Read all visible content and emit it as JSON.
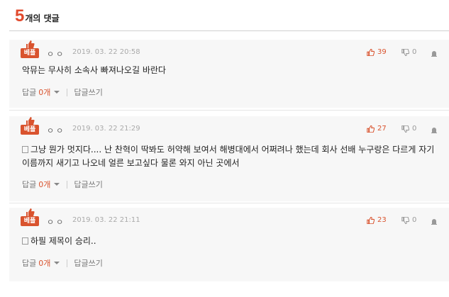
{
  "header": {
    "count": "5",
    "label": "개의 댓글"
  },
  "comments": [
    {
      "badge": "베플",
      "author": "ㅇㅇ",
      "date": "2019. 03. 22 20:58",
      "likes": "39",
      "dislikes": "0",
      "text": "악뮤는 무사히 소속사 빠져나오길 바란다",
      "has_doc_icon": false,
      "reply_label": "답글",
      "reply_count": "0개",
      "write_reply": "답글쓰기"
    },
    {
      "badge": "베플",
      "author": "ㅇㅇ",
      "date": "2019. 03. 22 21:29",
      "likes": "27",
      "dislikes": "0",
      "text": "그냥 뭔가 멋지다.... 난 찬혁이 딱봐도 허약해 보여서 해병대에서 어쩌려나 했는데 회사 선배 누구랑은 다르게 자기 이름까지 새기고 나오네 얼른 보고싶다 물론 와지 아닌 곳에서",
      "has_doc_icon": true,
      "reply_label": "답글",
      "reply_count": "0개",
      "write_reply": "답글쓰기"
    },
    {
      "badge": "베플",
      "author": "ㅇㅇ",
      "date": "2019. 03. 22 21:11",
      "likes": "23",
      "dislikes": "0",
      "text": "하필 제목이 승리..",
      "has_doc_icon": true,
      "reply_label": "답글",
      "reply_count": "0개",
      "write_reply": "답글쓰기"
    }
  ],
  "colors": {
    "accent": "#d9532e",
    "count": "#e14a2d"
  }
}
